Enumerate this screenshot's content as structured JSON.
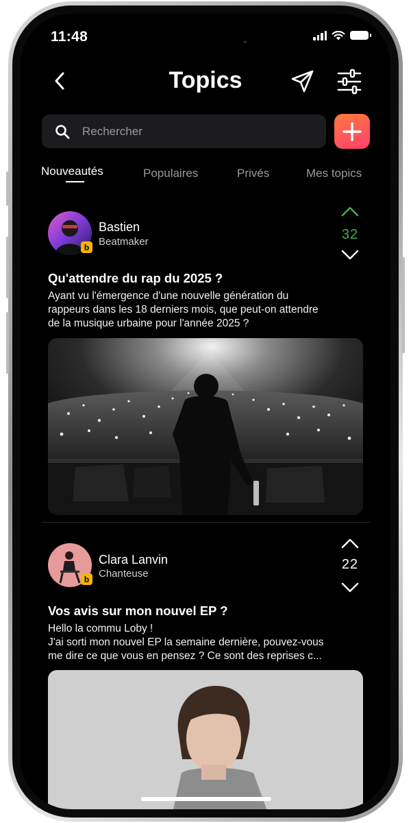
{
  "status_bar": {
    "time": "11:48"
  },
  "header": {
    "title": "Topics"
  },
  "search": {
    "placeholder": "Rechercher"
  },
  "tabs": [
    {
      "label": "Nouveautés",
      "active": true
    },
    {
      "label": "Populaires",
      "active": false
    },
    {
      "label": "Privés",
      "active": false
    },
    {
      "label": "Mes topics",
      "active": false
    }
  ],
  "posts": [
    {
      "author": "Bastien",
      "role": "Beatmaker",
      "votes": "32",
      "vote_color": "#4cae4c",
      "title": "Qu'attendre du rap du 2025 ?",
      "body": [
        "Ayant vu l'émergence d'une nouvelle génération du",
        "rappeurs dans les 18 derniers mois, que peut-on attendre",
        "de la musique urbaine pour l'année 2025 ?"
      ]
    },
    {
      "author": "Clara  Lanvin",
      "role": "Chanteuse",
      "votes": "22",
      "vote_color": "#ffffff",
      "title": "Vos avis sur mon nouvel EP ?",
      "body": [
        "Hello la commu Loby !",
        "J'ai sorti mon nouvel EP la semaine dernière, pouvez-vous",
        "me dire ce que vous en pensez ? Ce sont des reprises c..."
      ]
    }
  ],
  "colors": {
    "background": "#000000",
    "accent_gradient_start": "#ff7a3d",
    "accent_gradient_end": "#ff3f6e",
    "upvote_active": "#4cae4c",
    "badge": "#f4b400"
  },
  "icons": {
    "back": "chevron-left-icon",
    "send": "paper-plane-icon",
    "filter": "sliders-icon",
    "search": "search-icon",
    "add": "plus-icon",
    "upvote": "chevron-up-icon",
    "downvote": "chevron-down-icon"
  }
}
